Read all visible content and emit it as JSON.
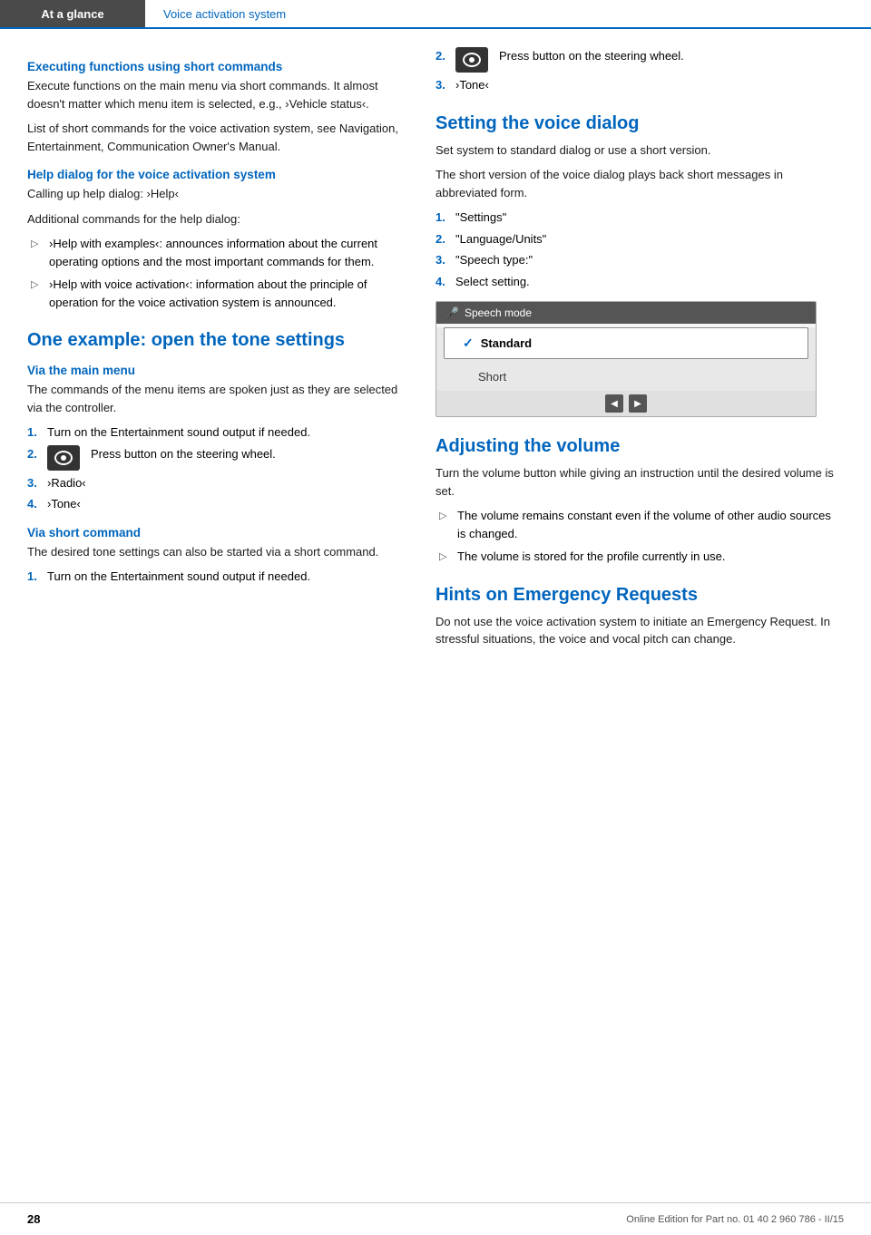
{
  "header": {
    "left_label": "At a glance",
    "right_label": "Voice activation system"
  },
  "left_col": {
    "section1": {
      "heading": "Executing functions using short commands",
      "para1": "Execute functions on the main menu via short commands. It almost doesn't matter which menu item is selected, e.g., ›Vehicle status‹.",
      "para2": "List of short commands for the voice activation system, see Navigation, Entertainment, Communication Owner's Manual."
    },
    "section2": {
      "heading": "Help dialog for the voice activation system",
      "para1": "Calling up help dialog: ›Help‹",
      "para2": "Additional commands for the help dialog:",
      "bullets": [
        {
          "text": "›Help with examples‹: announces information about the current operating options and the most important commands for them."
        },
        {
          "text": "›Help with voice activation‹: information about the principle of operation for the voice activation system is announced."
        }
      ]
    },
    "section3": {
      "heading_large": "One example: open the tone settings",
      "section3a": {
        "heading": "Via the main menu",
        "para1": "The commands of the menu items are spoken just as they are selected via the controller.",
        "steps": [
          {
            "num": "1.",
            "text": "Turn on the Entertainment sound output if needed."
          },
          {
            "num": "2.",
            "text": "Press button on the steering wheel."
          },
          {
            "num": "3.",
            "text": "›Radio‹"
          },
          {
            "num": "4.",
            "text": "›Tone‹"
          }
        ]
      },
      "section3b": {
        "heading": "Via short command",
        "para1": "The desired tone settings can also be started via a short command.",
        "steps": [
          {
            "num": "1.",
            "text": "Turn on the Entertainment sound output if needed."
          }
        ]
      }
    }
  },
  "right_col": {
    "section3b_continued": {
      "steps": [
        {
          "num": "2.",
          "text": "Press button on the steering wheel."
        },
        {
          "num": "3.",
          "text": "›Tone‹"
        }
      ]
    },
    "section4": {
      "heading_large": "Setting the voice dialog",
      "para1": "Set system to standard dialog or use a short version.",
      "para2": "The short version of the voice dialog plays back short messages in abbreviated form.",
      "steps": [
        {
          "num": "1.",
          "text": "\"Settings\""
        },
        {
          "num": "2.",
          "text": "\"Language/Units\""
        },
        {
          "num": "3.",
          "text": "\"Speech type:\""
        },
        {
          "num": "4.",
          "text": "Select setting."
        }
      ],
      "screenshot": {
        "title": "Speech mode",
        "items": [
          "Standard",
          "Short"
        ],
        "selected": "Standard"
      }
    },
    "section5": {
      "heading_large": "Adjusting the volume",
      "para1": "Turn the volume button while giving an instruction until the desired volume is set.",
      "bullets": [
        {
          "text": "The volume remains constant even if the volume of other audio sources is changed."
        },
        {
          "text": "The volume is stored for the profile currently in use."
        }
      ]
    },
    "section6": {
      "heading_large": "Hints on Emergency Requests",
      "para1": "Do not use the voice activation system to initiate an Emergency Request. In stressful situations, the voice and vocal pitch can change."
    }
  },
  "footer": {
    "page_number": "28",
    "info_text": "Online Edition for Part no. 01 40 2 960 786 - II/15"
  },
  "icons": {
    "steering_button": "steering-wheel-button-icon",
    "bullet_arrow": "▷",
    "checkmark": "✓",
    "speech_mode_icon": "🎤"
  }
}
